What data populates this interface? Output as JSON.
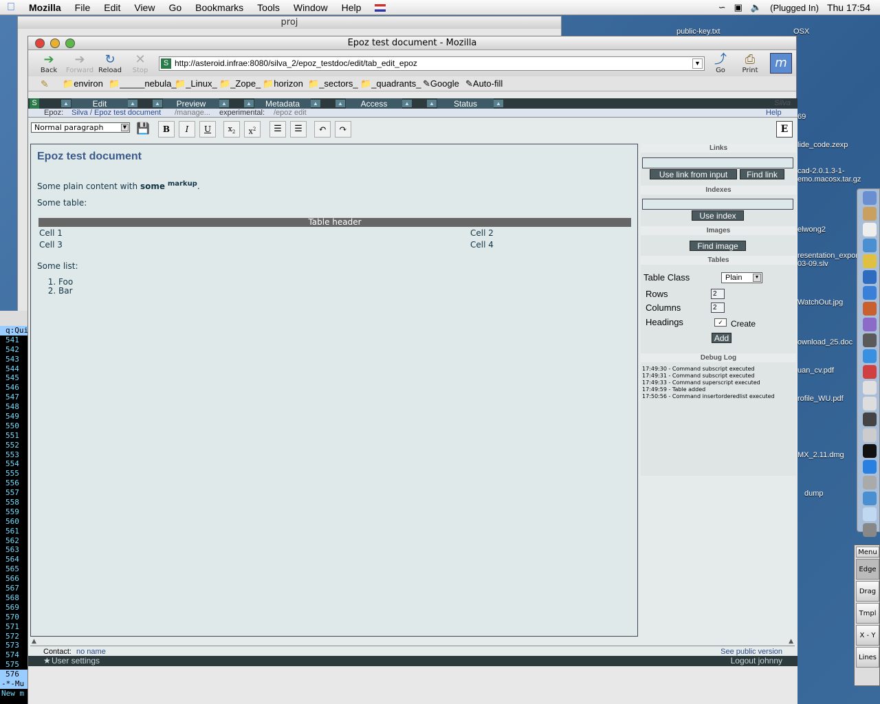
{
  "menubar": {
    "app": "Mozilla",
    "items": [
      "File",
      "Edit",
      "View",
      "Go",
      "Bookmarks",
      "Tools",
      "Window",
      "Help"
    ],
    "status": "(Plugged In)",
    "clock": "Thu 17:54"
  },
  "desktop": {
    "icons": [
      "public-key.txt",
      "OSX",
      "69",
      "lide_code.zexp",
      "cad-2.0.1.3-1-",
      "emo.macosx.tar.gz",
      "elwong2",
      "resentation_expor",
      "03-09.slv",
      "WatchOut.jpg",
      "ownload_25.doc",
      "uan_cv.pdf",
      "rofile_WU.pdf",
      "MX_2.11.dmg",
      "dump"
    ]
  },
  "backwin": {
    "title": "proj"
  },
  "terminal": {
    "header": "q:Qui",
    "lines": [
      "541",
      "542",
      "543",
      "544",
      "545",
      "546",
      "547",
      "548",
      "549",
      "550",
      "551",
      "552",
      "553",
      "554",
      "555",
      "556",
      "557",
      "558",
      "559",
      "560",
      "561",
      "562",
      "563",
      "564",
      "565",
      "566",
      "567",
      "568",
      "569",
      "570",
      "571",
      "572",
      "573",
      "574",
      "575"
    ],
    "foot1": "576",
    "foot2": "-*-Mu",
    "foot3": "New m"
  },
  "palette": [
    "Menu",
    "Edge",
    "Drag",
    "Tmpl",
    "X - Y",
    "Lines"
  ],
  "window": {
    "title": "Epoz test document - Mozilla",
    "nav": {
      "back": "Back",
      "forward": "Forward",
      "reload": "Reload",
      "stop": "Stop",
      "go": "Go",
      "print": "Print"
    },
    "url": "http://asteroid.infrae:8080/silva_2/epoz_testdoc/edit/tab_edit_epoz",
    "bookmarks": [
      "environ",
      "_____nebula_",
      "_Linux_",
      "_Zope_",
      "horizon",
      "_sectors_",
      "_quadrants_",
      "Google",
      "Auto-fill"
    ]
  },
  "silva": {
    "tabs": [
      "Edit",
      "Preview",
      "Metadata",
      "Access",
      "Status"
    ],
    "brand": "Silva",
    "crumbs": {
      "label": "Epoz:",
      "path": "Silva / Epoz test document",
      "manage": "/manage...",
      "exp": "experimental:",
      "epoz": "/epoz edit",
      "help": "Help"
    }
  },
  "toolbar": {
    "paragraph": "Normal paragraph",
    "bold": "B",
    "italic": "I",
    "underline": "U"
  },
  "doc": {
    "title": "Epoz test document",
    "p1": "Some plain content with",
    "p1_bold": "some",
    "p1_sup": "markup",
    "p1_end": ".",
    "p2": "Some table:",
    "table": {
      "header": "Table header",
      "rows": [
        [
          "Cell 1",
          "Cell 2"
        ],
        [
          "Cell 3",
          "Cell 4"
        ]
      ]
    },
    "p3": "Some list:",
    "list": [
      "Foo",
      "Bar"
    ]
  },
  "sidebar": {
    "links": "Links",
    "use_link": "Use link from input",
    "find_link": "Find link",
    "indexes": "Indexes",
    "use_index": "Use index",
    "images": "Images",
    "find_image": "Find image",
    "tables": "Tables",
    "table_class_label": "Table Class",
    "table_class": "Plain",
    "rows_label": "Rows",
    "rows": "2",
    "columns_label": "Columns",
    "columns": "2",
    "headings_label": "Headings",
    "create": "Create",
    "add": "Add",
    "debug": "Debug Log",
    "log": [
      "17:49:30 - Command subscript executed",
      "17:49:31 - Command subscript executed",
      "17:49:33 - Command superscript executed",
      "17:49:59 - Table added",
      "17:50:56 - Command insertorderedlist executed"
    ]
  },
  "footer": {
    "contact": "Contact:",
    "contact_name": "no name",
    "public": "See public version",
    "settings": "User settings",
    "logout": "Logout johnny"
  }
}
